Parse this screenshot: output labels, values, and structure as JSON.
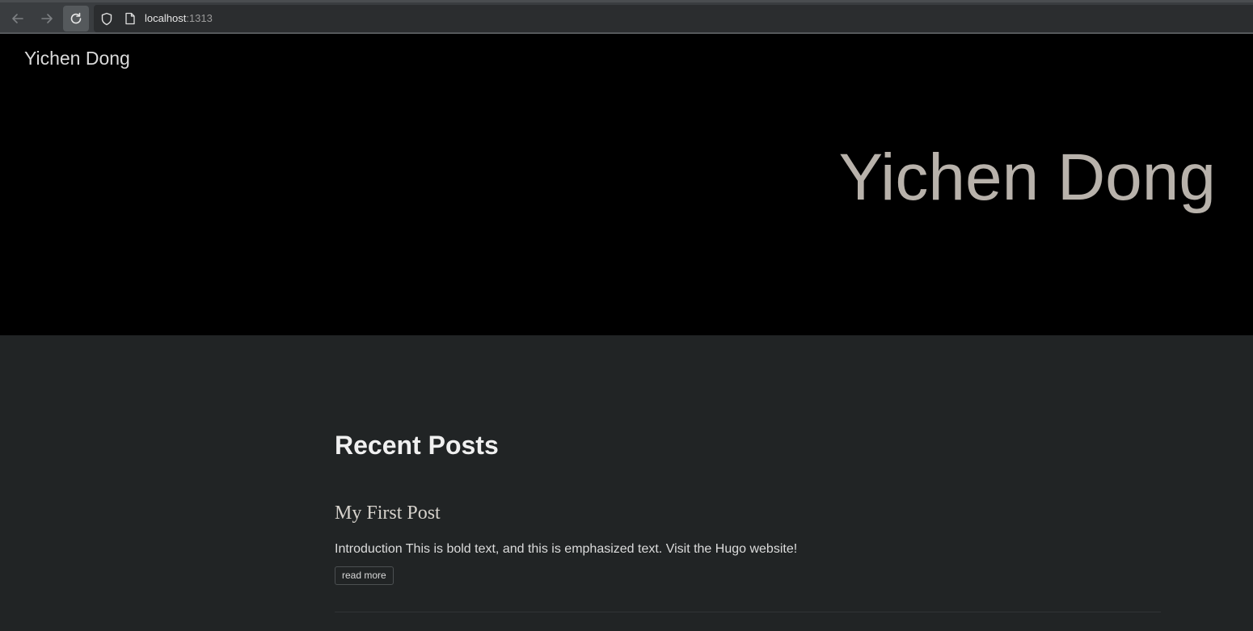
{
  "browser": {
    "url_host": "localhost",
    "url_port": ":1313",
    "icons": [
      "back-arrow-icon",
      "forward-arrow-icon",
      "reload-icon",
      "shield-icon",
      "page-icon"
    ]
  },
  "site": {
    "title": "Yichen Dong"
  },
  "hero": {
    "title": "Yichen Dong"
  },
  "main": {
    "section_heading": "Recent Posts",
    "posts": [
      {
        "title": "My First Post",
        "summary": "Introduction This is bold text, and this is emphasized text. Visit the Hugo website!",
        "read_more_label": "read more"
      }
    ]
  },
  "colors": {
    "hero_background": "#000000",
    "page_background": "#212425",
    "hero_title": "#b8b2ab"
  }
}
